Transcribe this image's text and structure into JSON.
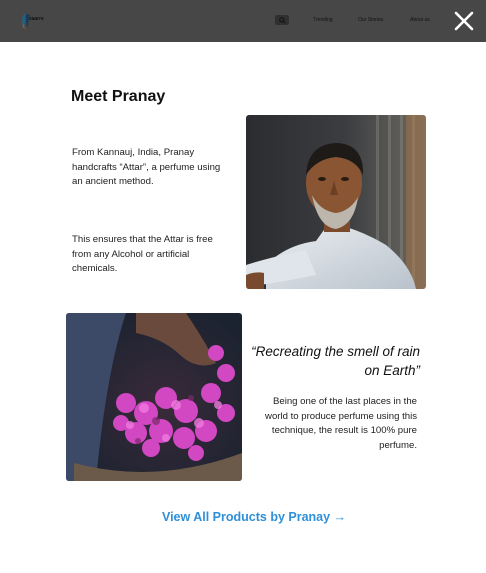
{
  "header": {
    "logo_text": "zaarre",
    "nav": [
      "Trending",
      "Our Stories",
      "About us"
    ],
    "search_icon": "search-icon"
  },
  "modal": {
    "close_icon": "close-icon",
    "title": "Meet Pranay",
    "intro": "From Kannauj, India, Pranay handcrafts “Attar”, a perfume using an ancient method.",
    "purity": "This ensures that the Attar is free from any Alcohol or artificial chemicals.",
    "quote": "“Recreating the smell of rain on Earth”",
    "detail": "Being one of the last places in the world to produce perfume using this technique, the result is 100% pure perfume.",
    "cta": "View All Products by Pranay →"
  },
  "colors": {
    "overlay_header": "#474747",
    "accent_link": "#2f8fd8",
    "text": "#111111"
  }
}
